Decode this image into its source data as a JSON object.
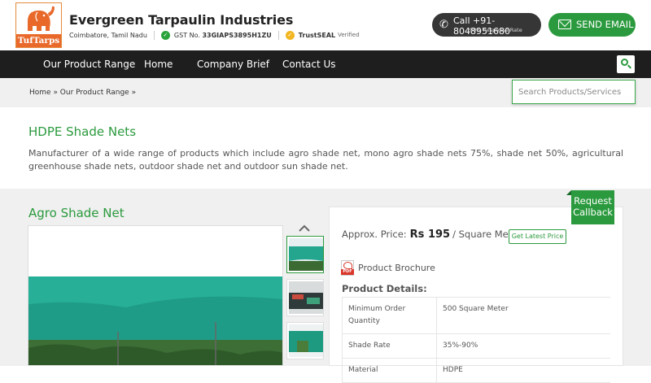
{
  "brand": {
    "logo_text": "TufTarps",
    "company_name": "Evergreen Tarpaulin Industries",
    "location": "Coimbatore, Tamil Nadu",
    "gst_label": "GST No.",
    "gst_number": "33GIAPS3895H1ZU",
    "trustseal_label": "TrustSEAL",
    "trustseal_status": "Verified"
  },
  "header_actions": {
    "call_label": "Call +91-8048951680",
    "call_subtext": "90% Response Rate",
    "email_label": "SEND EMAIL"
  },
  "nav": {
    "items": [
      {
        "label": "Our Product Range"
      },
      {
        "label": "Home"
      },
      {
        "label": "Company Brief"
      },
      {
        "label": "Contact Us"
      }
    ]
  },
  "breadcrumb": {
    "text": "Home » Our Product Range »"
  },
  "search": {
    "placeholder": "Search Products/Services"
  },
  "category": {
    "title": "HDPE Shade Nets",
    "description": "Manufacturer of a wide range of products which include agro shade net, mono agro shade nets 75%, shade net 50%, agricultural greenhouse shade nets, outdoor shade net and outdoor sun shade net."
  },
  "product": {
    "name": "Agro Shade Net",
    "price_prefix": "Approx. Price:",
    "price": "Rs 195",
    "price_unit": "/ Square Meter",
    "latest_price_button": "Get Latest Price",
    "callback_line1": "Request",
    "callback_line2": "Callback",
    "brochure_label": "Product Brochure",
    "pdf_tag": "PDF",
    "details_title": "Product Details:",
    "specs": [
      {
        "key": "Minimum Order Quantity",
        "value": "500 Square Meter"
      },
      {
        "key": "Shade Rate",
        "value": "35%-90%"
      },
      {
        "key": "Material",
        "value": "HDPE"
      }
    ]
  },
  "colors": {
    "accent_green": "#2b9a3e",
    "nav_bg": "#1e1e1e",
    "call_bg": "#363636",
    "logo_orange": "#e8692a"
  }
}
